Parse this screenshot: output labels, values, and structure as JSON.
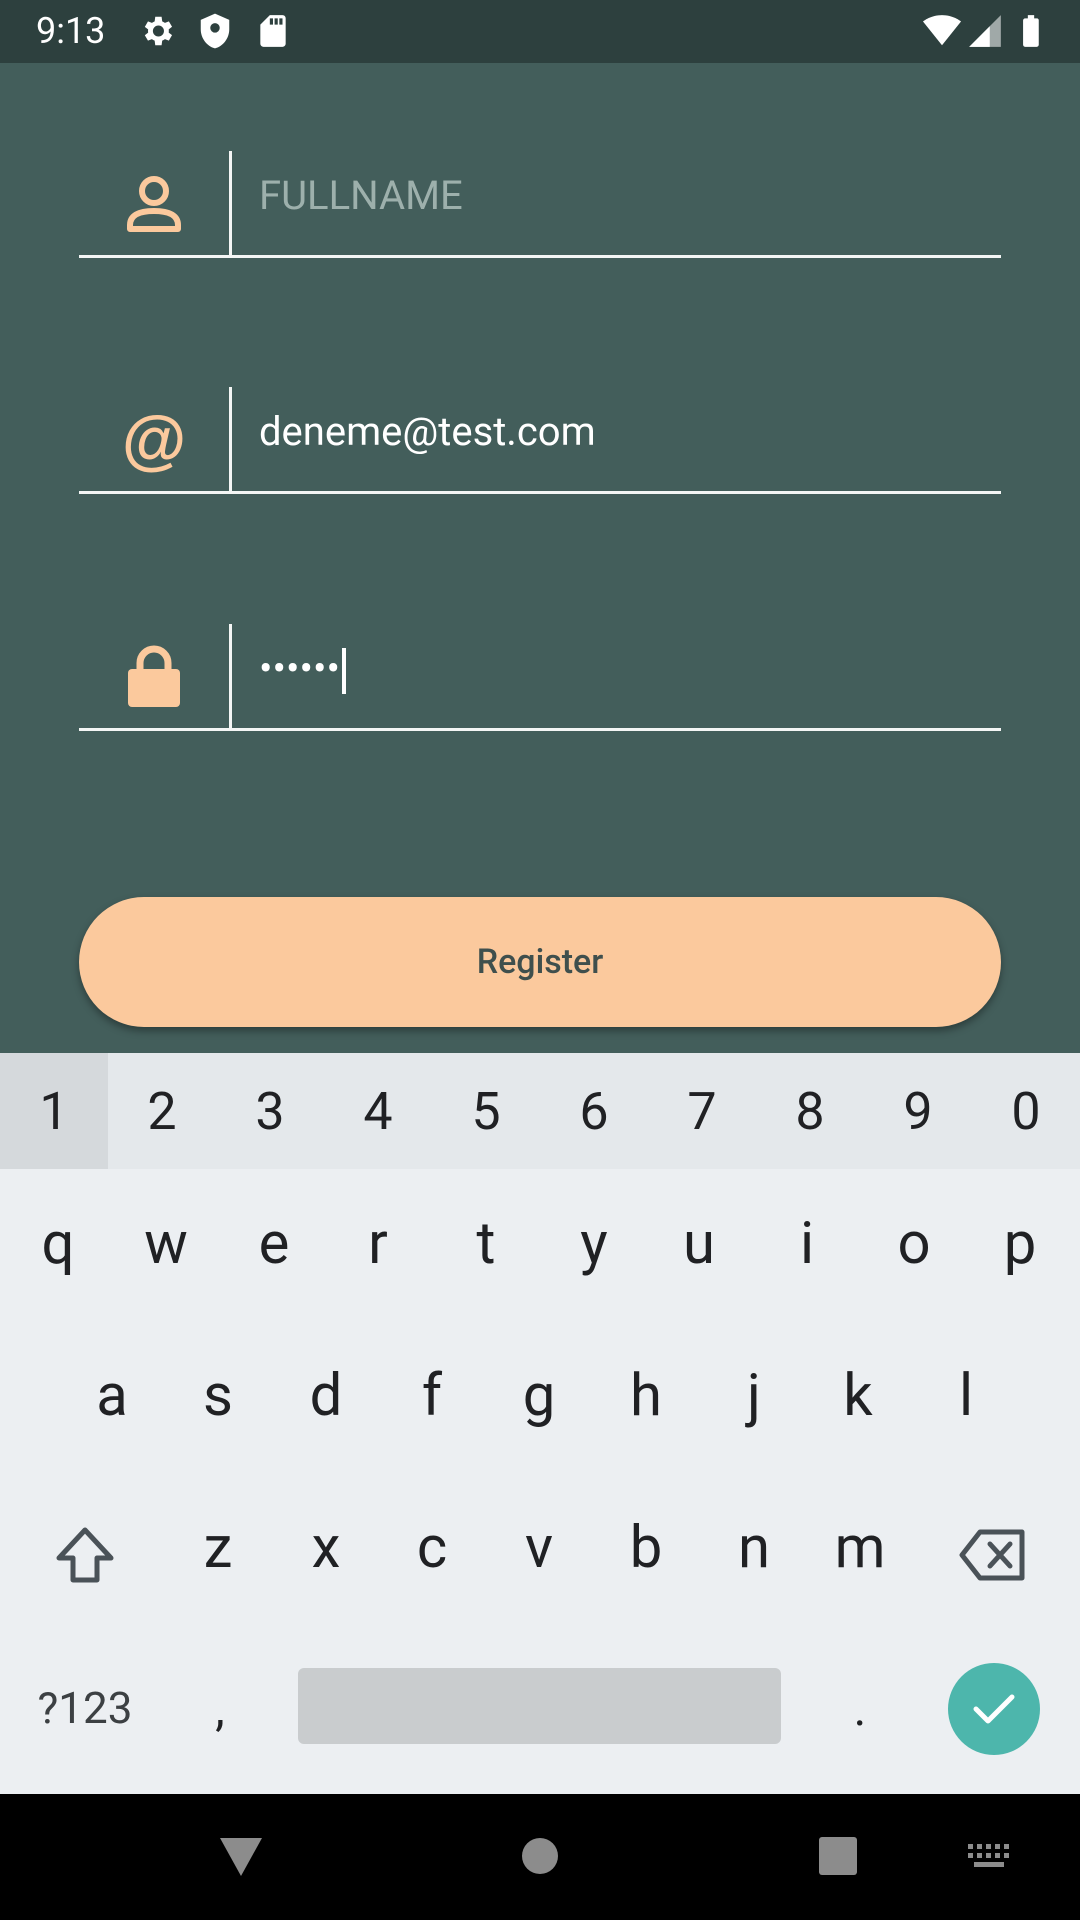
{
  "status_bar": {
    "time": "9:13",
    "left_icons": [
      "gear-icon",
      "shield-icon",
      "sd-card-icon"
    ],
    "right_icons": [
      "wifi-icon",
      "signal-icon",
      "battery-icon"
    ]
  },
  "form": {
    "fullname": {
      "placeholder": "FULLNAME",
      "value": ""
    },
    "email": {
      "value": "deneme@test.com",
      "icon_text": "@"
    },
    "password": {
      "masked_value": "••••••"
    },
    "register_label": "Register"
  },
  "keyboard": {
    "number_row": [
      "1",
      "2",
      "3",
      "4",
      "5",
      "6",
      "7",
      "8",
      "9",
      "0"
    ],
    "row1": [
      "q",
      "w",
      "e",
      "r",
      "t",
      "y",
      "u",
      "i",
      "o",
      "p"
    ],
    "row2": [
      "a",
      "s",
      "d",
      "f",
      "g",
      "h",
      "j",
      "k",
      "l"
    ],
    "row3": [
      "z",
      "x",
      "c",
      "v",
      "b",
      "n",
      "m"
    ],
    "symbols_label": "?123",
    "comma": ",",
    "period": "."
  },
  "colors": {
    "background": "#435e5b",
    "accent": "#fbc99d",
    "keyboard_bg": "#eceff2",
    "enter_key": "#4db6ac"
  }
}
